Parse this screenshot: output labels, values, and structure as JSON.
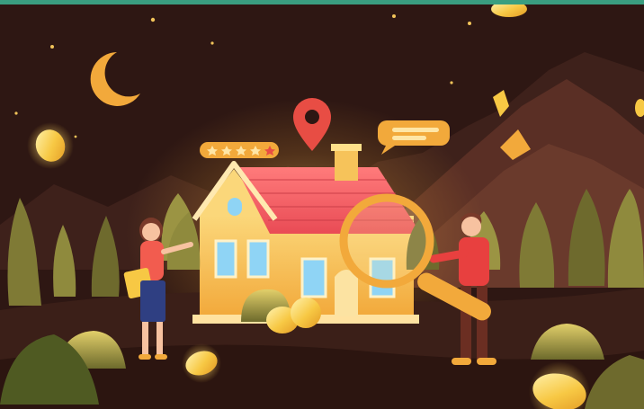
{
  "colors": {
    "top_bar": "#3a9e80",
    "sky": "#2e1713",
    "ground": "#3b1f18",
    "accent_orange": "#f2a93b",
    "roof_red": "#ef5b5b",
    "pin_red": "#e84d44",
    "coin_gold": "#f7c844",
    "plant_green": "#b7b04a"
  },
  "illustration": {
    "elements": [
      "moon-icon",
      "location-pin-icon",
      "rating-stars-icon",
      "speech-bubble-icon",
      "house",
      "magnifier-icon",
      "coin-icon",
      "woman-figure",
      "man-figure",
      "mountains",
      "bushes"
    ],
    "rating_stars": 5
  }
}
